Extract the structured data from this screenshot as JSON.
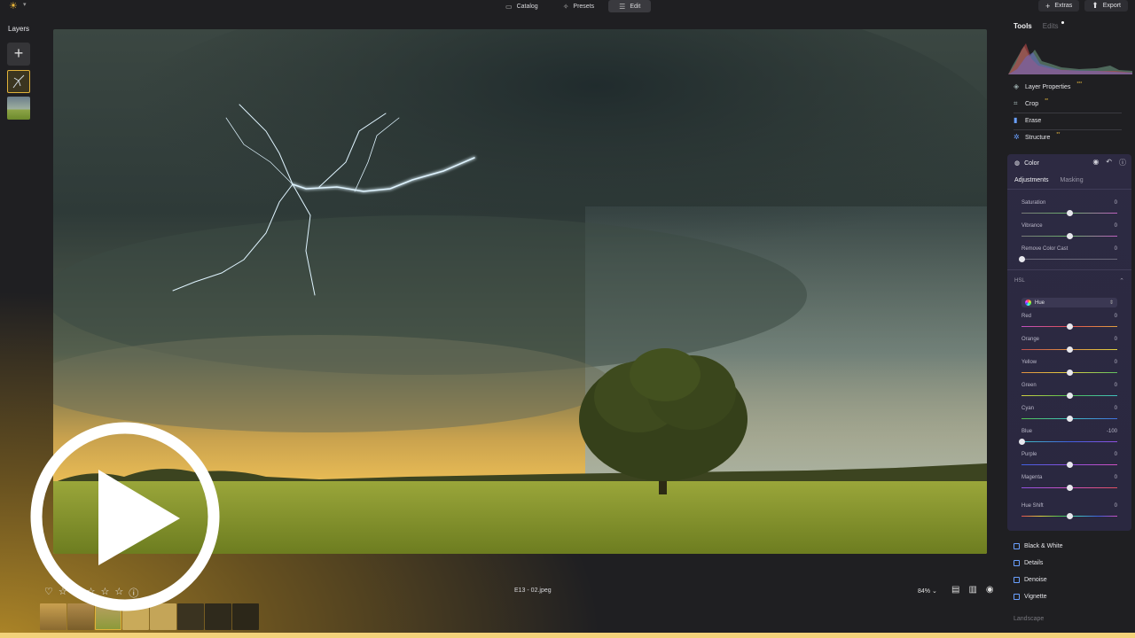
{
  "topbar": {
    "logo_icon": "sun-logo-icon",
    "nav": [
      {
        "label": "Catalog",
        "icon": "folder-icon",
        "active": false
      },
      {
        "label": "Presets",
        "icon": "sparkle-icon",
        "active": false
      },
      {
        "label": "Edit",
        "icon": "sliders-icon",
        "active": true
      }
    ],
    "extras_label": "Extras",
    "export_label": "Export"
  },
  "layers": {
    "title": "Layers",
    "add_symbol": "+"
  },
  "bottom_bar": {
    "rating_icons": [
      "heart-icon",
      "star-icon",
      "star-icon",
      "star-icon",
      "star-icon",
      "star-icon",
      "info-icon"
    ],
    "filename": "E13 - 02.jpeg",
    "zoom": "84%"
  },
  "right_panel": {
    "tab_tools": "Tools",
    "tab_edits": "Edits",
    "tools": [
      {
        "label": "Layer Properties",
        "star": "***"
      },
      {
        "label": "Crop",
        "star": "**"
      },
      {
        "label": "Erase",
        "star": ""
      },
      {
        "label": "Structure",
        "star": "**"
      }
    ],
    "color": {
      "title": "Color",
      "tab_adjustments": "Adjustments",
      "tab_masking": "Masking",
      "sliders": [
        {
          "label": "Saturation",
          "value": "0",
          "position": 0.5
        },
        {
          "label": "Vibrance",
          "value": "0",
          "position": 0.5
        },
        {
          "label": "Remove Color Cast",
          "value": "0",
          "position": 0.0
        }
      ],
      "hsl_label": "HSL",
      "hue_select": "Hue",
      "hsl_sliders": [
        {
          "label": "Red",
          "value": "0",
          "position": 0.5
        },
        {
          "label": "Orange",
          "value": "0",
          "position": 0.5
        },
        {
          "label": "Yellow",
          "value": "0",
          "position": 0.5
        },
        {
          "label": "Green",
          "value": "0",
          "position": 0.5
        },
        {
          "label": "Cyan",
          "value": "0",
          "position": 0.5
        },
        {
          "label": "Blue",
          "value": "-100",
          "position": 0.0
        },
        {
          "label": "Purple",
          "value": "0",
          "position": 0.5
        },
        {
          "label": "Magenta",
          "value": "0",
          "position": 0.5
        },
        {
          "label": "Hue Shift",
          "value": "0",
          "position": 0.5
        }
      ]
    },
    "more_tools": [
      {
        "label": "Black & White"
      },
      {
        "label": "Details"
      },
      {
        "label": "Denoise"
      },
      {
        "label": "Vignette"
      }
    ],
    "section": "Landscape"
  },
  "colors": {
    "accent": "#e1b23a",
    "panel_purple": "#2d2a42"
  }
}
